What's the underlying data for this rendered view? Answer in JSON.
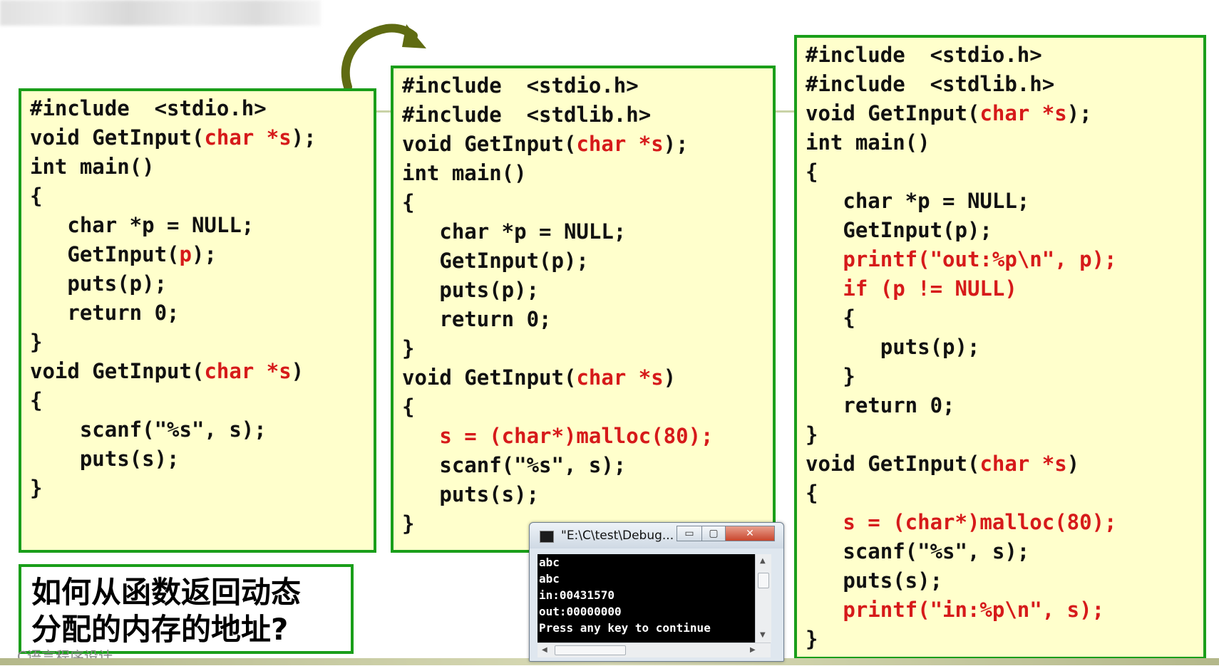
{
  "colors": {
    "panel_background": "#ffffcc",
    "panel_border": "#1a9e1a",
    "highlight": "#d61a1a",
    "arrow": "#5f6b12"
  },
  "panels": [
    {
      "lines": [
        "#include  <stdio.h>",
        "void GetInput(char *s);",
        "int main()",
        "{",
        "   char *p = NULL;",
        "   GetInput(p);",
        "   puts(p);",
        "   return 0;",
        "}",
        "void GetInput(char *s)",
        "{",
        "    scanf(\"%s\", s);",
        "    puts(s);",
        "}"
      ]
    },
    {
      "lines": [
        "#include  <stdio.h>",
        "#include  <stdlib.h>",
        "void GetInput(char *s);",
        "int main()",
        "{",
        "   char *p = NULL;",
        "   GetInput(p);",
        "   puts(p);",
        "   return 0;",
        "}",
        "void GetInput(char *s)",
        "{",
        "   s = (char*)malloc(80);",
        "   scanf(\"%s\", s);",
        "   puts(s);",
        "}"
      ]
    },
    {
      "lines": [
        "#include  <stdio.h>",
        "#include  <stdlib.h>",
        "void GetInput(char *s);",
        "int main()",
        "{",
        "   char *p = NULL;",
        "   GetInput(p);",
        "   printf(\"out:%p\\n\", p);",
        "   if (p != NULL)",
        "   {",
        "      puts(p);",
        "   }",
        "   return 0;",
        "}",
        "void GetInput(char *s)",
        "{",
        "   s = (char*)malloc(80);",
        "   scanf(\"%s\", s);",
        "   puts(s);",
        "   printf(\"in:%p\\n\", s);",
        "}"
      ]
    }
  ],
  "question": {
    "line1": "如何从函数返回动态",
    "line2": "分配的内存的地址?"
  },
  "footer_text": "C语言程序设计",
  "console": {
    "title": "\"E:\\C\\test\\Debug...",
    "minimize": "▭",
    "maximize": "▢",
    "close": "✕",
    "output": [
      "abc",
      "abc",
      "in:00431570",
      "out:00000000",
      "Press any key to continue"
    ]
  }
}
